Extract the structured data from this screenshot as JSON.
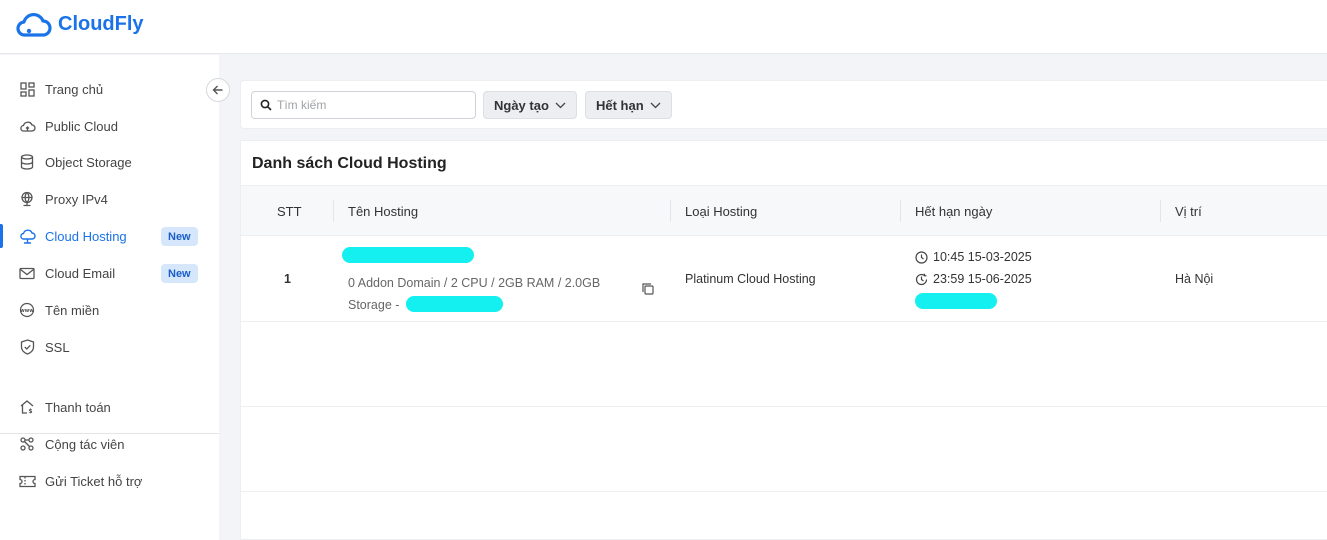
{
  "brand": {
    "name": "CloudFly"
  },
  "sidebar": {
    "items": [
      {
        "label": "Trang chủ",
        "icon": "dashboard-icon"
      },
      {
        "label": "Public Cloud",
        "icon": "cloud-icon"
      },
      {
        "label": "Object Storage",
        "icon": "storage-icon"
      },
      {
        "label": "Proxy IPv4",
        "icon": "globe-pin-icon"
      },
      {
        "label": "Cloud Hosting",
        "icon": "cloud-outline-icon",
        "active": true,
        "badge": "New"
      },
      {
        "label": "Cloud Email",
        "icon": "mail-icon",
        "badge": "New"
      },
      {
        "label": "Tên miền",
        "icon": "www-icon"
      },
      {
        "label": "SSL",
        "icon": "shield-check-icon"
      },
      {
        "label": "Thanh toán",
        "icon": "payment-house-icon"
      },
      {
        "label": "Cộng tác viên",
        "icon": "network-icon"
      },
      {
        "label": "Gửi Ticket hỗ trợ",
        "icon": "ticket-icon"
      }
    ]
  },
  "filters": {
    "search_placeholder": "Tìm kiếm",
    "created_label": "Ngày tạo",
    "expire_label": "Hết hạn"
  },
  "table": {
    "title": "Danh sách Cloud Hosting",
    "columns": {
      "stt": "STT",
      "name": "Tên Hosting",
      "type": "Loại Hosting",
      "expire": "Hết hạn ngày",
      "location": "Vị trí"
    },
    "rows": [
      {
        "stt": "1",
        "spec": "0 Addon Domain / 2 CPU / 2GB RAM / 2.0GB Storage -",
        "type": "Platinum Cloud Hosting",
        "created_time": "10:45 15-03-2025",
        "expire_time": "23:59 15-06-2025",
        "location": "Hà Nội"
      }
    ]
  },
  "colors": {
    "accent": "#1a73e8",
    "redaction": "#14f0f0",
    "badge_bg": "#d6e6fb"
  }
}
